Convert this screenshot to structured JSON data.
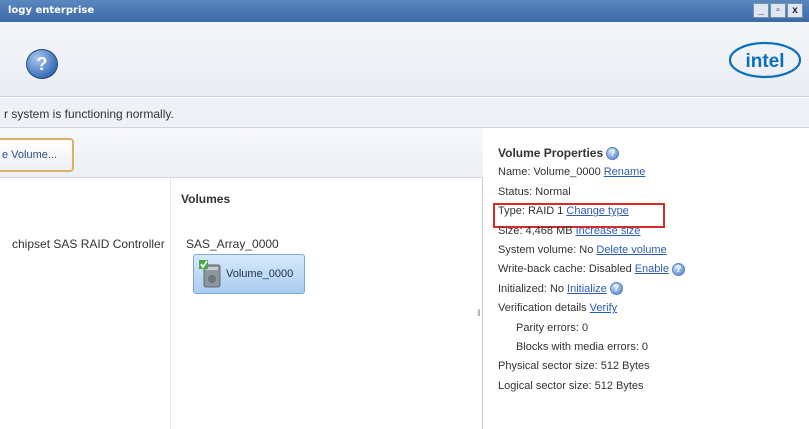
{
  "window": {
    "title": "logy enterprise",
    "minimize": "_",
    "maximize": "▫",
    "close": "x"
  },
  "header": {
    "help_icon": "help-icon",
    "help_glyph": "?",
    "logo_text": "intel",
    "brand_color": "#0b6fc0"
  },
  "status": {
    "message": "r system is functioning normally."
  },
  "toolbar": {
    "create_volume_label": "e Volume..."
  },
  "tree": {
    "controller_label": "chipset SAS RAID Controller",
    "volumes_header": "Volumes",
    "array_label": "SAS_Array_0000",
    "volume_name": "Volume_0000"
  },
  "properties": {
    "title": "Volume Properties",
    "name_label": "Name: Volume_0000",
    "rename_link": "Rename",
    "status_label": "Status: Normal",
    "type_label": "Type: RAID 1",
    "change_type_link": "Change type",
    "size_label": "Size: 4,468 MB",
    "increase_size_link": "Increase size",
    "system_volume_label": "System volume: No",
    "delete_volume_link": "Delete volume",
    "write_back_label": "Write-back cache: Disabled",
    "enable_link": "Enable",
    "initialized_label": "Initialized: No",
    "initialize_link": "Initialize",
    "verification_label": "Verification details",
    "verify_link": "Verify",
    "parity_errors_label": "Parity errors: 0",
    "media_errors_label": "Blocks with media errors: 0",
    "physical_sector_label": "Physical sector size: 512 Bytes",
    "logical_sector_label": "Logical sector size: 512 Bytes",
    "highlight_color": "#d62b2b"
  }
}
